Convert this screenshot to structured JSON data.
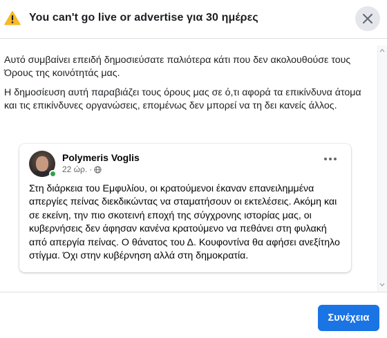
{
  "dialog": {
    "title": "You can't go live or advertise για 30 ημέρες",
    "icons": {
      "warning": "warning-triangle-icon",
      "close": "close-x-icon"
    },
    "colors": {
      "warning": "#f7b928",
      "primary": "#1b74e4"
    }
  },
  "body": {
    "paragraph_1": "Αυτό συμβαίνει επειδή δημοσιεύσατε παλιότερα κάτι που δεν ακολουθούσε τους Όρους της κοινότητάς μας.",
    "paragraph_2": "Η δημοσίευση αυτή παραβιάζει τους όρους μας σε ό,τι αφορά τα επικίνδυνα άτομα και τις επικίνδυνες οργανώσεις, επομένως δεν μπορεί να τη δει κανείς άλλος."
  },
  "post": {
    "author": "Polymeris Voglis",
    "time": "22 ώρ.",
    "separator": "·",
    "audience_icon": "globe-icon",
    "text": "Στη διάρκεια του Εμφυλίου, οι κρατούμενοι έκαναν επανειλημμένα απεργίες πείνας διεκδικώντας να σταματήσουν οι εκτελέσεις. Ακόμη και σε εκείνη, την πιο σκοτεινή εποχή της σύγχρονης ιστορίας μας, οι κυβερνήσεις δεν άφησαν κανένα κρατούμενο να πεθάνει στη φυλακή από απεργία πείνας. Ο θάνατος του Δ. Κουφοντίνα θα αφήσει ανεξίτηλο στίγμα. Όχι στην κυβέρνηση αλλά στη δημοκρατία."
  },
  "footer": {
    "continue_label": "Συνέχεια"
  }
}
